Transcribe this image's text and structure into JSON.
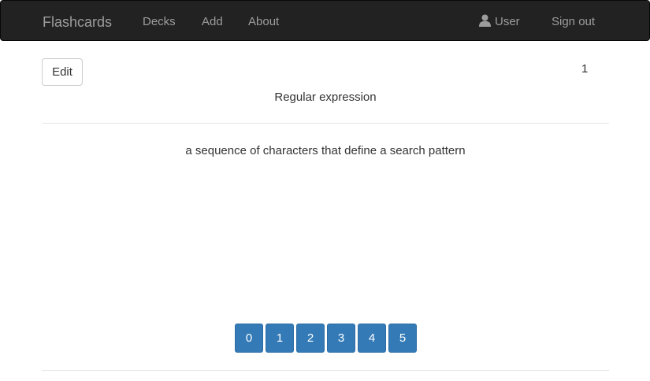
{
  "navbar": {
    "brand": "Flashcards",
    "links": [
      "Decks",
      "Add",
      "About"
    ],
    "user_label": "User",
    "signout_label": "Sign out",
    "user_icon": "user-icon"
  },
  "card": {
    "edit_label": "Edit",
    "count": "1",
    "term": "Regular expression",
    "definition": "a sequence of characters that define a search pattern"
  },
  "ratings": [
    "0",
    "1",
    "2",
    "3",
    "4",
    "5"
  ],
  "colors": {
    "navbar_bg": "#222222",
    "nav_text": "#9d9d9d",
    "button_primary": "#337ab7",
    "button_primary_border": "#2e6da4"
  }
}
